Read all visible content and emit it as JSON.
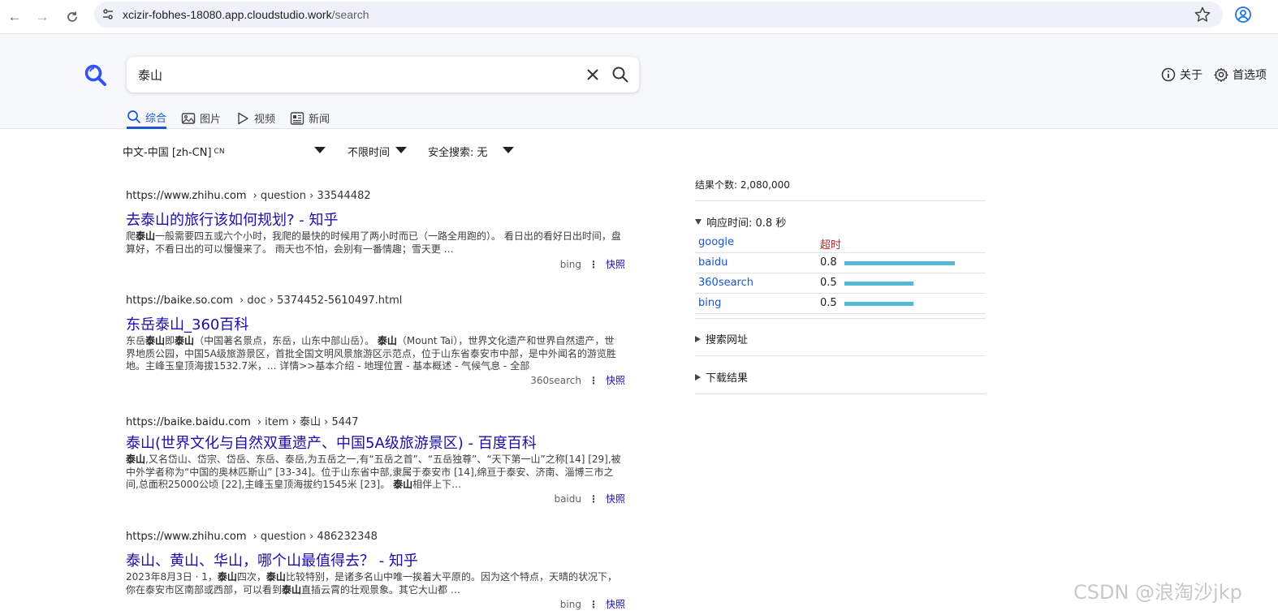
{
  "browser": {
    "url_host": "xcizir-fobhes-18080.app.cloudstudio.work",
    "url_path": "/search"
  },
  "search": {
    "query": "泰山"
  },
  "header": {
    "about_label": "关于",
    "prefs_label": "首选项"
  },
  "tabs": [
    {
      "label": "综合",
      "icon": "search-icon",
      "active": true
    },
    {
      "label": "图片",
      "icon": "image-icon",
      "active": false
    },
    {
      "label": "视频",
      "icon": "play-icon",
      "active": false
    },
    {
      "label": "新闻",
      "icon": "news-icon",
      "active": false
    }
  ],
  "filters": {
    "language": "中文-中国 [zh-CN]",
    "language_suffix": "CN",
    "time": "不限时间",
    "safe": "安全搜索: 无"
  },
  "results": [
    {
      "host": "https://www.zhihu.com",
      "crumb": "› question › 33544482",
      "title": "去泰山的旅行该如何规划? - 知乎",
      "snippet_html": "爬<b>泰山</b>一般需要四五或六个小时，我爬的最快的时候用了两小时而已（一路全用跑的）。 看日出的看好日出时间，盘算好，不看日出的可以慢慢来了。 雨天也不怕，会别有一番情趣；雪天更 …",
      "engine": "bing",
      "cache": "快照"
    },
    {
      "host": "https://baike.so.com",
      "crumb": "› doc › 5374452-5610497.html",
      "title": "东岳泰山_360百科",
      "snippet_html": "东岳<b>泰山</b>即<b>泰山</b>（中国著名景点，东岳，山东中部山岳）。 <b>泰山</b>（Mount Tai），世界文化遗产和世界自然遗产，世界地质公园，中国5A级旅游景区，首批全国文明风景旅游区示范点，位于山东省泰安市中部，是中外闻名的游览胜地。主峰玉皇顶海拔1532.7米，... 详情>>基本介绍 - 地理位置 - 基本概述 - 气候气息 - 全部",
      "engine": "360search",
      "cache": "快照"
    },
    {
      "host": "https://baike.baidu.com",
      "crumb": "› item › 泰山 › 5447",
      "title": "泰山(世界文化与自然双重遗产、中国5A级旅游景区) - 百度百科",
      "snippet_html": "<b>泰山</b>,又名岱山、岱宗、岱岳、东岳、泰岳,为五岳之一,有“五岳之首”、“五岳独尊”、“天下第一山”之称[14] [29],被中外学者称为“中国的奥林匹斯山” [33-34]。位于山东省中部,隶属于泰安市 [14],绵亘于泰安、济南、淄博三市之间,总面积25000公顷 [22],主峰玉皇顶海拔约1545米 [23]。 <b>泰山</b>相伴上下…",
      "engine": "baidu",
      "cache": "快照"
    },
    {
      "host": "https://www.zhihu.com",
      "crumb": "› question › 486232348",
      "title": "泰山、黄山、华山，哪个山最值得去？ - 知乎",
      "snippet_html": "2023年8月3日 · 1，<b>泰山</b>四次，<b>泰山</b>比较特别，是诸多名山中唯一挨着大平原的。因为这个特点，天晴的状况下，你在泰安市区南部或西部，可以看到<b>泰山</b>直插云霄的壮观景象。其它大山都 …",
      "engine": "bing",
      "cache": "快照"
    }
  ],
  "sidebar": {
    "result_count": "结果个数: 2,080,000",
    "response_title": "响应时间: 0.8 秒",
    "engines": [
      {
        "name": "google",
        "time": "超时",
        "timeout": true,
        "value": 0
      },
      {
        "name": "baidu",
        "time": "0.8",
        "timeout": false,
        "value": 0.8
      },
      {
        "name": "360search",
        "time": "0.5",
        "timeout": false,
        "value": 0.5
      },
      {
        "name": "bing",
        "time": "0.5",
        "timeout": false,
        "value": 0.5
      }
    ],
    "search_url_label": "搜索网址",
    "download_label": "下载结果"
  },
  "watermark": "CSDN @浪淘沙jkp",
  "colors": {
    "link": "#1a0dab",
    "accent": "#1a55d0",
    "bar": "#55b9d6",
    "timeout": "#c5221f"
  }
}
